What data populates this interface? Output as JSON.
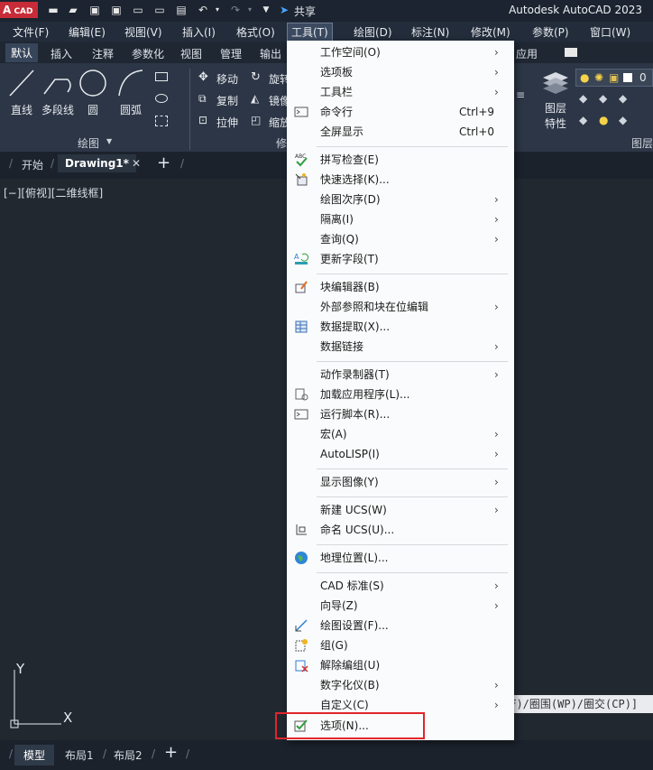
{
  "app": {
    "logo_text": "A",
    "logo_sub": "CAD",
    "title": "Autodesk AutoCAD 2023",
    "share": "共享"
  },
  "menubar": [
    "文件(F)",
    "编辑(E)",
    "视图(V)",
    "插入(I)",
    "格式(O)",
    "工具(T)",
    "绘图(D)",
    "标注(N)",
    "修改(M)",
    "参数(P)",
    "窗口(W)"
  ],
  "ribbon_tabs": [
    "默认",
    "插入",
    "注释",
    "参数化",
    "视图",
    "管理",
    "输出",
    "应用"
  ],
  "ribbon": {
    "draw_tools": [
      "直线",
      "多段线",
      "圆",
      "圆弧"
    ],
    "draw_panel": "绘图",
    "modify_tools": [
      "移动",
      "旋转",
      "复制",
      "镜像",
      "拉伸",
      "缩放"
    ],
    "modify_panel": "修",
    "layer_tools": [
      "图层",
      "特性"
    ],
    "layer_panel": "图层",
    "layer_value": "0"
  },
  "doc_tabs": {
    "start": "开始",
    "drawing": "Drawing1*"
  },
  "viewport_label": "[−][俯视][二维线框]",
  "command_line": "(F)/圈围(WP)/圈交(CP)]",
  "ucs": {
    "y": "Y",
    "x": "X"
  },
  "layout_tabs": [
    "模型",
    "布局1",
    "布局2"
  ],
  "colors": {
    "accent": "#e0262b",
    "menu_bg": "#fafbfc",
    "canvas": "#212830"
  },
  "tools_menu": [
    {
      "label": "工作空间(O)",
      "submenu": true
    },
    {
      "label": "选项板",
      "submenu": true
    },
    {
      "label": "工具栏",
      "submenu": true
    },
    {
      "label": "命令行",
      "shortcut": "Ctrl+9",
      "icon": "command-line-icon"
    },
    {
      "label": "全屏显示",
      "shortcut": "Ctrl+0"
    },
    {
      "label": "拼写检查(E)",
      "icon": "spell-check-icon"
    },
    {
      "label": "快速选择(K)...",
      "icon": "quick-select-icon"
    },
    {
      "label": "绘图次序(D)",
      "submenu": true
    },
    {
      "label": "隔离(I)",
      "submenu": true
    },
    {
      "label": "查询(Q)",
      "submenu": true
    },
    {
      "label": "更新字段(T)",
      "icon": "update-field-icon"
    },
    {
      "label": "块编辑器(B)",
      "icon": "block-editor-icon"
    },
    {
      "label": "外部参照和块在位编辑",
      "submenu": true
    },
    {
      "label": "数据提取(X)...",
      "icon": "data-extraction-icon"
    },
    {
      "label": "数据链接",
      "submenu": true
    },
    {
      "label": "动作录制器(T)",
      "submenu": true
    },
    {
      "label": "加载应用程序(L)...",
      "icon": "load-application-icon"
    },
    {
      "label": "运行脚本(R)...",
      "icon": "run-script-icon"
    },
    {
      "label": "宏(A)",
      "submenu": true
    },
    {
      "label": "AutoLISP(I)",
      "submenu": true
    },
    {
      "label": "显示图像(Y)",
      "submenu": true
    },
    {
      "label": "新建 UCS(W)",
      "submenu": true
    },
    {
      "label": "命名 UCS(U)...",
      "icon": "named-ucs-icon"
    },
    {
      "label": "地理位置(L)...",
      "icon": "globe-icon"
    },
    {
      "label": "CAD 标准(S)",
      "submenu": true
    },
    {
      "label": "向导(Z)",
      "submenu": true
    },
    {
      "label": "绘图设置(F)...",
      "icon": "drafting-settings-icon"
    },
    {
      "label": "组(G)",
      "icon": "group-icon"
    },
    {
      "label": "解除编组(U)",
      "icon": "ungroup-icon"
    },
    {
      "label": "数字化仪(B)",
      "submenu": true
    },
    {
      "label": "自定义(C)",
      "submenu": true
    },
    {
      "label": "选项(N)...",
      "icon": "options-check-icon"
    }
  ]
}
